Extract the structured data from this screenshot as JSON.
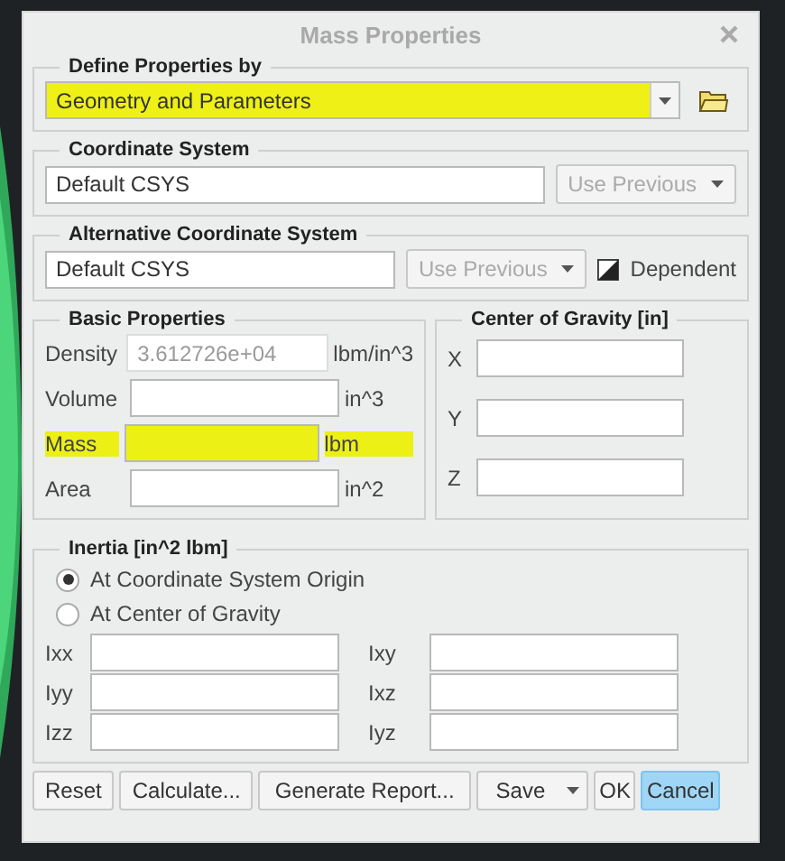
{
  "window": {
    "title": "Mass Properties"
  },
  "define_by": {
    "label": "Define Properties by",
    "value": "Geometry and Parameters",
    "highlighted": true
  },
  "coordinate_system": {
    "label": "Coordinate System",
    "value": "Default CSYS",
    "button": {
      "label": "Use Previous",
      "disabled": true
    }
  },
  "alternative_coordinate_system": {
    "label": "Alternative Coordinate System",
    "value": "Default CSYS",
    "button": {
      "label": "Use Previous",
      "disabled": true
    },
    "dependent": "Dependent"
  },
  "basic_properties": {
    "label": "Basic Properties",
    "rows": [
      {
        "label": "Density",
        "value": "3.612726e+04",
        "unit": "lbm/in^3",
        "disabled": true,
        "highlighted": false
      },
      {
        "label": "Volume",
        "unit": "in^3",
        "disabled": false,
        "highlighted": false
      },
      {
        "label": "Mass",
        "unit": "lbm",
        "disabled": false,
        "highlighted": true
      },
      {
        "label": "Area",
        "unit": "in^2",
        "disabled": false,
        "highlighted": false
      }
    ]
  },
  "center_of_gravity": {
    "label": "Center of Gravity [in]",
    "axes": [
      "X",
      "Y",
      "Z"
    ]
  },
  "inertia": {
    "label": "Inertia [in^2 lbm]",
    "options": [
      {
        "label": "At Coordinate System Origin",
        "selected": true
      },
      {
        "label": "At Center of Gravity",
        "selected": false
      }
    ],
    "fields": [
      "Ixx",
      "Ixy",
      "Iyy",
      "Ixz",
      "Izz",
      "Iyz"
    ]
  },
  "buttons": [
    {
      "label": "Reset",
      "kind": "plain",
      "focused": false
    },
    {
      "label": "Calculate...",
      "kind": "plain",
      "focused": false
    },
    {
      "label": "Generate Report...",
      "kind": "plain",
      "focused": false
    },
    {
      "label": "Save",
      "kind": "split",
      "focused": false
    },
    {
      "label": "OK",
      "kind": "plain",
      "focused": false
    },
    {
      "label": "Cancel",
      "kind": "plain",
      "focused": true
    }
  ]
}
